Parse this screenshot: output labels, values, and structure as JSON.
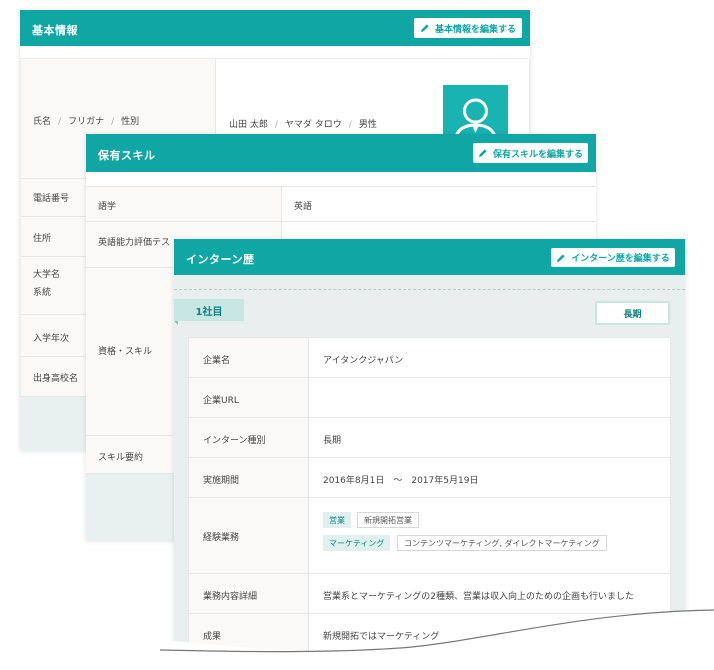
{
  "basic_info": {
    "title": "基本情報",
    "edit_label": "基本情報を編集する",
    "name_label": {
      "a": "氏名",
      "b": "フリガナ",
      "c": "性別"
    },
    "name_value": {
      "a": "山田 太郎",
      "b": "ヤマダ タロウ",
      "c": "男性"
    },
    "labels": {
      "phone": "電話番号",
      "address": "住所",
      "university_a": "大学名",
      "university_b": "系統",
      "entry_year": "入学年次",
      "high_school": "出身高校名"
    }
  },
  "skills": {
    "title": "保有スキル",
    "edit_label": "保有スキルを編集する",
    "rows": {
      "language_label": "語学",
      "language_value": "英語",
      "test_label": "英語能力評価テス",
      "cert_label": "資格・スキル",
      "summary_label": "スキル要約"
    }
  },
  "internship": {
    "title": "インターン歴",
    "edit_label": "インターン歴を編集する",
    "company_tag": "1社目",
    "period_badge": "長期",
    "rows": {
      "company_label": "企業名",
      "company_value": "アイタンクジャパン",
      "url_label": "企業URL",
      "url_value": "",
      "type_label": "インターン種別",
      "type_value": "長期",
      "period_label": "実施期間",
      "period_value": "2016年8月1日　～　2017年5月19日",
      "experience_label": "経験業務",
      "experience_chips": {
        "primary1": "営業",
        "sub1": "新規開拓営業",
        "primary2": "マーケティング",
        "sub2": "コンテンツマーケティング, ダイレクトマーケティング"
      },
      "detail_label": "業務内容詳細",
      "detail_value": "営業系とマーケティングの2種類、営業は収入向上のための企画も行いました",
      "result_label": "成果",
      "result_value": "新規開拓ではマーケティング"
    }
  },
  "colors": {
    "header_teal": "#10a6a4",
    "tag_teal": "#c7e6e4",
    "panel_bg": "#e8efee"
  }
}
